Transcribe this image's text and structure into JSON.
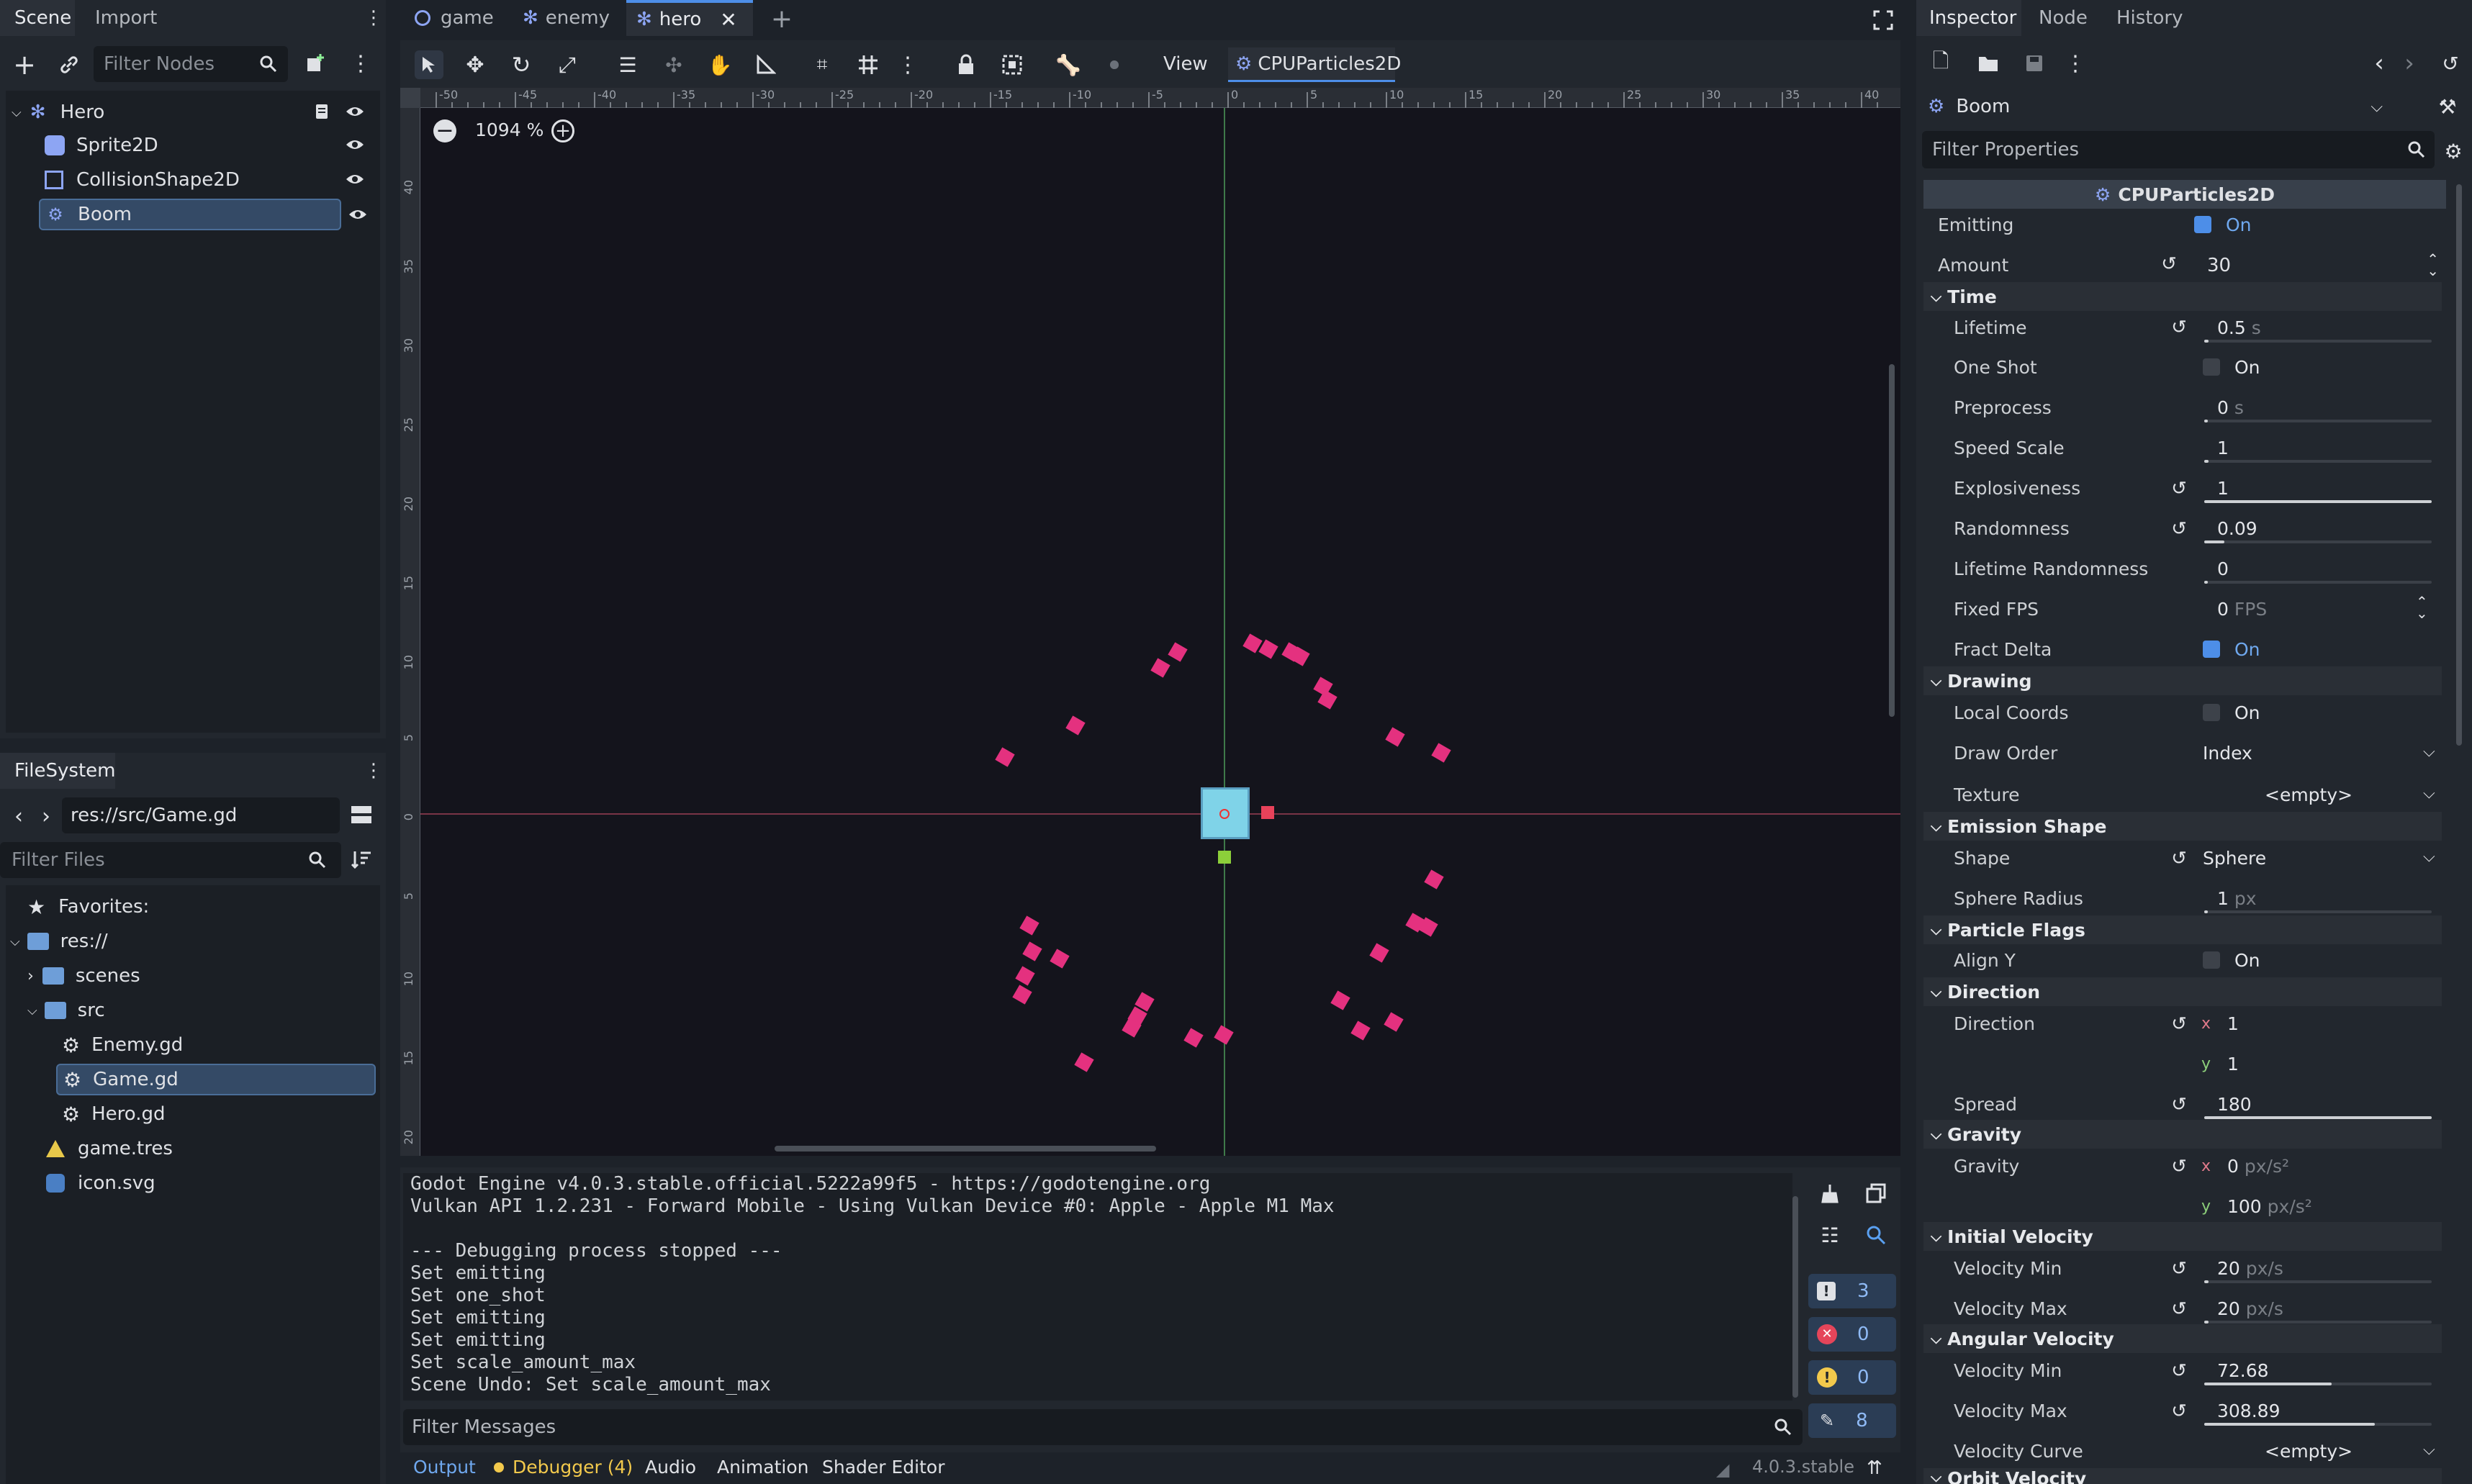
{
  "scene_dock": {
    "tabs": [
      "Scene",
      "Import"
    ],
    "filter_placeholder": "Filter Nodes",
    "nodes": [
      {
        "name": "Hero",
        "icon": "character-body-icon"
      },
      {
        "name": "Sprite2D",
        "icon": "sprite-icon"
      },
      {
        "name": "CollisionShape2D",
        "icon": "collision-shape-icon"
      },
      {
        "name": "Boom",
        "icon": "particles-icon"
      }
    ]
  },
  "filesystem": {
    "tab": "FileSystem",
    "path": "res://src/Game.gd",
    "filter_placeholder": "Filter Files",
    "items": [
      {
        "label": "Favorites:",
        "icon": "star-icon"
      },
      {
        "label": "res://",
        "icon": "folder-icon"
      },
      {
        "label": "scenes",
        "icon": "folder-icon"
      },
      {
        "label": "src",
        "icon": "folder-icon"
      },
      {
        "label": "Enemy.gd",
        "icon": "gear-icon"
      },
      {
        "label": "Game.gd",
        "icon": "gear-icon"
      },
      {
        "label": "Hero.gd",
        "icon": "gear-icon"
      },
      {
        "label": "game.tres",
        "icon": "resource-icon"
      },
      {
        "label": "icon.svg",
        "icon": "image-icon"
      }
    ]
  },
  "editor_tabs": [
    "game",
    "enemy",
    "hero"
  ],
  "toolbar": {
    "view_label": "View",
    "node_menu": "CPUParticles2D"
  },
  "viewport": {
    "zoom": "1094 %",
    "ruler_top": [
      "-50",
      "-45",
      "-40",
      "-35",
      "-30",
      "-25",
      "-20",
      "-15",
      "-10",
      "-5",
      "0",
      "5",
      "10",
      "15",
      "20",
      "25",
      "30",
      "35",
      "40"
    ],
    "ruler_left": [
      "40",
      "35",
      "30",
      "25",
      "20",
      "15",
      "10",
      "5",
      "0",
      "5",
      "10",
      "15",
      "20"
    ]
  },
  "output": {
    "lines": [
      "Godot Engine v4.0.3.stable.official.5222a99f5 - https://godotengine.org",
      "Vulkan API 1.2.231 - Forward Mobile - Using Vulkan Device #0: Apple - Apple M1 Max",
      "",
      "--- Debugging process stopped ---",
      "Set emitting",
      "Set one_shot",
      "Set emitting",
      "Set emitting",
      "Set scale_amount_max",
      "Scene Undo: Set scale_amount_max"
    ],
    "filter_placeholder": "Filter Messages",
    "counts": {
      "messages": "3",
      "errors": "0",
      "warnings": "0",
      "editor": "8"
    }
  },
  "bottom_tabs": {
    "output": "Output",
    "debugger": "Debugger (4)",
    "audio": "Audio",
    "animation": "Animation",
    "shader_editor": "Shader Editor",
    "version": "4.0.3.stable"
  },
  "inspector": {
    "tabs": [
      "Inspector",
      "Node",
      "History"
    ],
    "object": "Boom",
    "filter_placeholder": "Filter Properties",
    "class_name": "CPUParticles2D",
    "emitting": {
      "label": "Emitting",
      "value": "On"
    },
    "amount": {
      "label": "Amount",
      "value": "30"
    },
    "sections": {
      "time": "Time",
      "drawing": "Drawing",
      "emission_shape": "Emission Shape",
      "particle_flags": "Particle Flags",
      "direction": "Direction",
      "gravity": "Gravity",
      "initial_velocity": "Initial Velocity",
      "angular_velocity": "Angular Velocity",
      "orbit_velocity": "Orbit Velocity"
    },
    "props": {
      "lifetime": {
        "label": "Lifetime",
        "value": "0.5",
        "unit": "s",
        "fill": 0.02
      },
      "one_shot": {
        "label": "One Shot",
        "value": "On"
      },
      "preprocess": {
        "label": "Preprocess",
        "value": "0",
        "unit": "s",
        "fill": 0.0
      },
      "speed_scale": {
        "label": "Speed Scale",
        "value": "1",
        "fill": 0.02
      },
      "explosiveness": {
        "label": "Explosiveness",
        "value": "1",
        "fill": 1.0
      },
      "randomness": {
        "label": "Randomness",
        "value": "0.09",
        "fill": 0.09
      },
      "lifetime_randomness": {
        "label": "Lifetime Randomness",
        "value": "0",
        "fill": 0.0
      },
      "fixed_fps": {
        "label": "Fixed FPS",
        "value": "0",
        "unit": "FPS"
      },
      "fract_delta": {
        "label": "Fract Delta",
        "value": "On"
      },
      "local_coords": {
        "label": "Local Coords",
        "value": "On"
      },
      "draw_order": {
        "label": "Draw Order",
        "value": "Index"
      },
      "texture": {
        "label": "Texture",
        "value": "<empty>"
      },
      "shape": {
        "label": "Shape",
        "value": "Sphere"
      },
      "sphere_radius": {
        "label": "Sphere Radius",
        "value": "1",
        "unit": "px",
        "fill": 0.01
      },
      "align_y": {
        "label": "Align Y",
        "value": "On"
      },
      "direction": {
        "label": "Direction",
        "x": "1",
        "y": "1"
      },
      "spread": {
        "label": "Spread",
        "value": "180",
        "fill": 1.0
      },
      "gravity": {
        "label": "Gravity",
        "x": "0",
        "y": "100",
        "unit": "px/s²"
      },
      "velocity_min": {
        "label": "Velocity Min",
        "value": "20",
        "unit": "px/s",
        "fill": 0.02
      },
      "velocity_max": {
        "label": "Velocity Max",
        "value": "20",
        "unit": "px/s",
        "fill": 0.02
      },
      "ang_velocity_min": {
        "label": "Velocity Min",
        "value": "72.68",
        "fill": 0.56
      },
      "ang_velocity_max": {
        "label": "Velocity Max",
        "value": "308.89",
        "fill": 0.75
      },
      "velocity_curve": {
        "label": "Velocity Curve",
        "value": "<empty>"
      }
    }
  },
  "colors": {
    "accent": "#4d8ee8",
    "particle": "#e4317f",
    "background": "#14141c",
    "selection": "#344a66"
  }
}
